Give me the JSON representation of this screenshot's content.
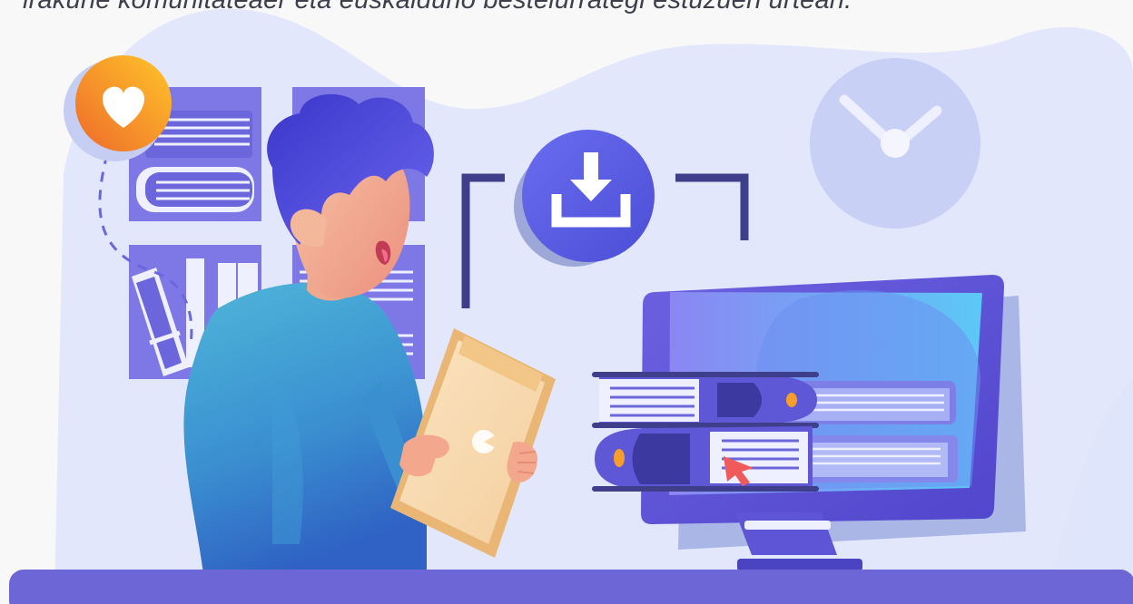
{
  "caption": {
    "text": "irakurle komunitateaer eta euskalduno bestelurrategi estuzuen urtean."
  },
  "colors": {
    "background": "#f8f8f8",
    "blob": "#e1e6fb",
    "accent": "#6264e0",
    "heart_badge": "#f79e2a",
    "skin": "#f3b89a",
    "hair": "#5358e2",
    "sweater": "#3f8fd4",
    "folder": "#f8d9ad",
    "screen": "#6fa1f6",
    "floor": "#6c66d7"
  },
  "icons": {
    "download": "download-icon",
    "heart": "heart-icon",
    "clock": "clock-icon",
    "cursor": "cursor-icon"
  }
}
